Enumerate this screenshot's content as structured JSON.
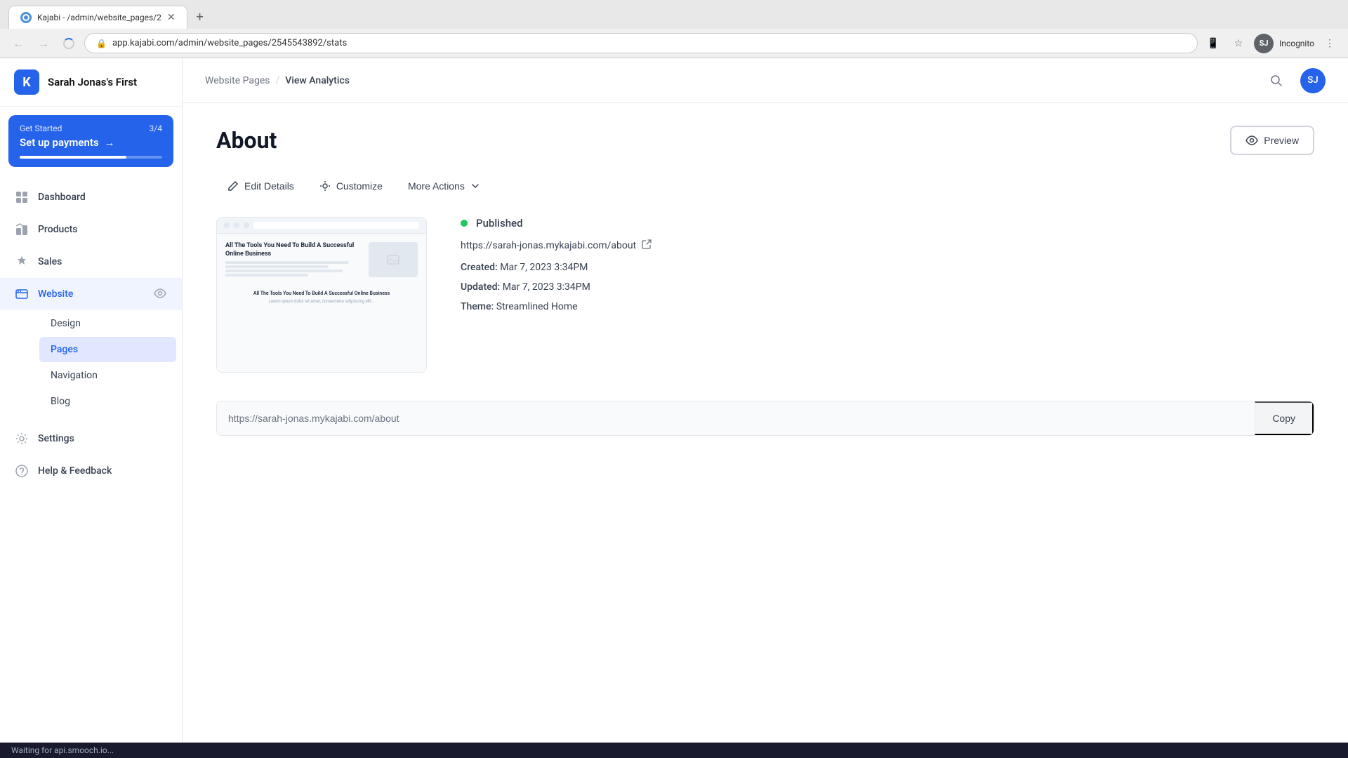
{
  "browser": {
    "tab_title": "Kajabi - /admin/website_pages/2",
    "tab_loading": true,
    "address": "app.kajabi.com/admin/website_pages/2545543892/stats",
    "incognito_label": "Incognito"
  },
  "sidebar": {
    "logo_text": "Sarah Jonas's First",
    "logo_initial": "K",
    "cta": {
      "label": "Get Started",
      "count": "3/4",
      "action": "Set up payments",
      "arrow": "→"
    },
    "nav_items": [
      {
        "id": "dashboard",
        "label": "Dashboard",
        "icon": "🏠"
      },
      {
        "id": "products",
        "label": "Products",
        "icon": "🏷"
      },
      {
        "id": "sales",
        "label": "Sales",
        "icon": "💎"
      },
      {
        "id": "website",
        "label": "Website",
        "icon": "🖥",
        "active": true,
        "has_eye": true
      }
    ],
    "sub_items": [
      {
        "id": "design",
        "label": "Design"
      },
      {
        "id": "pages",
        "label": "Pages",
        "active": true
      },
      {
        "id": "navigation",
        "label": "Navigation"
      },
      {
        "id": "blog",
        "label": "Blog"
      }
    ],
    "settings": {
      "id": "settings",
      "label": "Settings",
      "icon": "⚙"
    },
    "help": {
      "id": "help",
      "label": "Help & Feedback",
      "icon": "❓"
    }
  },
  "header": {
    "breadcrumb_parent": "Website Pages",
    "breadcrumb_separator": "/",
    "breadcrumb_current": "View Analytics",
    "avatar_initials": "SJ"
  },
  "page": {
    "title": "About",
    "preview_button": "Preview",
    "toolbar": {
      "edit_details": "Edit Details",
      "customize": "Customize",
      "more_actions": "More Actions"
    },
    "status": "Published",
    "url": "https://sarah-jonas.mykajabi.com/about",
    "created_label": "Created:",
    "created_value": "Mar 7, 2023 3:34PM",
    "updated_label": "Updated:",
    "updated_value": "Mar 7, 2023 3:34PM",
    "theme_label": "Theme:",
    "theme_value": "Streamlined Home",
    "copy_url": "https://sarah-jonas.mykajabi.com/about",
    "copy_button": "Copy"
  },
  "preview_thumbnail": {
    "headline": "All The Tools You Need To Build A Successful Online Business",
    "section_title": "All The Tools You Need To Build A Successful Online Business",
    "section_text": "Lorem ipsum dolor sit amet, consectetur adipiscing elit..."
  },
  "status_bar": {
    "text": "Waiting for api.smooch.io..."
  },
  "icons": {
    "search": "🔍",
    "eye": "👁",
    "external_link": "↗",
    "preview": "👁"
  }
}
